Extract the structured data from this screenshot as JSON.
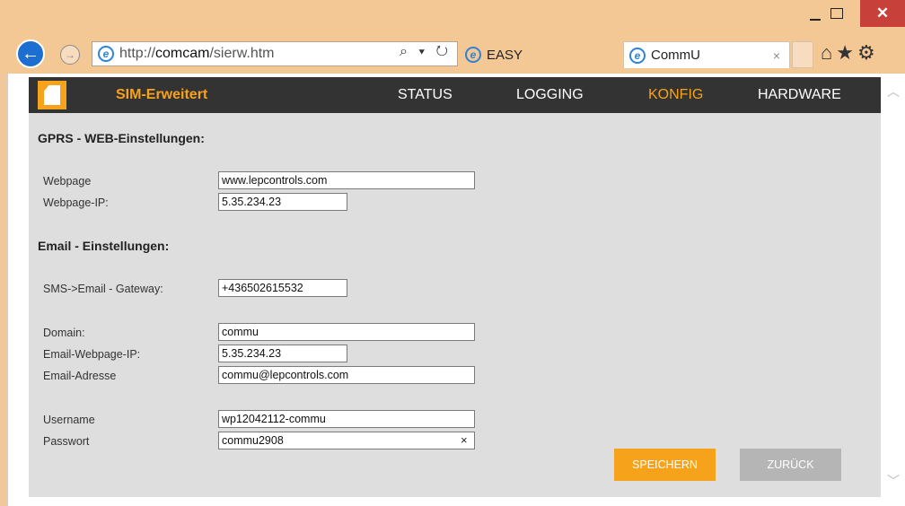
{
  "browser": {
    "url_prefix": "http://",
    "url_host": "comcam",
    "url_path": "/sierw.htm",
    "url_tools": "⌕ ▾ ↻",
    "tabs": [
      {
        "label": "EASY"
      },
      {
        "label": "CommU",
        "close": "×"
      }
    ],
    "ie_glyph": "e",
    "back_glyph": "←",
    "forward_glyph": "→",
    "toolbar_glyphs": "⌂★⚙",
    "close_glyph": "✕"
  },
  "app": {
    "brand": "SIM-Erweitert",
    "nav": [
      {
        "label": "STATUS"
      },
      {
        "label": "LOGGING"
      },
      {
        "label": "KONFIG",
        "active": true
      },
      {
        "label": "HARDWARE"
      }
    ],
    "accent": "#f7a21b"
  },
  "gprs": {
    "title": "GPRS - WEB-Einstellungen:",
    "webpage_label": "Webpage",
    "webpage_value": "www.lepcontrols.com",
    "webpage_ip_label": "Webpage-IP:",
    "webpage_ip_value": "5.35.234.23"
  },
  "email": {
    "title": "Email - Einstellungen:",
    "gateway_label": "SMS->Email - Gateway:",
    "gateway_value": "+436502615532",
    "domain_label": "Domain:",
    "domain_value": "commu",
    "email_ip_label": "Email-Webpage-IP:",
    "email_ip_value": "5.35.234.23",
    "address_label": "Email-Adresse",
    "address_value": "commu@lepcontrols.com",
    "username_label": "Username",
    "username_value": "wp12042112-commu",
    "password_label": "Passwort",
    "password_value": "commu2908",
    "clear_glyph": "×"
  },
  "actions": {
    "save": "SPEICHERN",
    "back": "ZURÜCK"
  },
  "scroll": {
    "up": "︿",
    "down": "﹀"
  }
}
